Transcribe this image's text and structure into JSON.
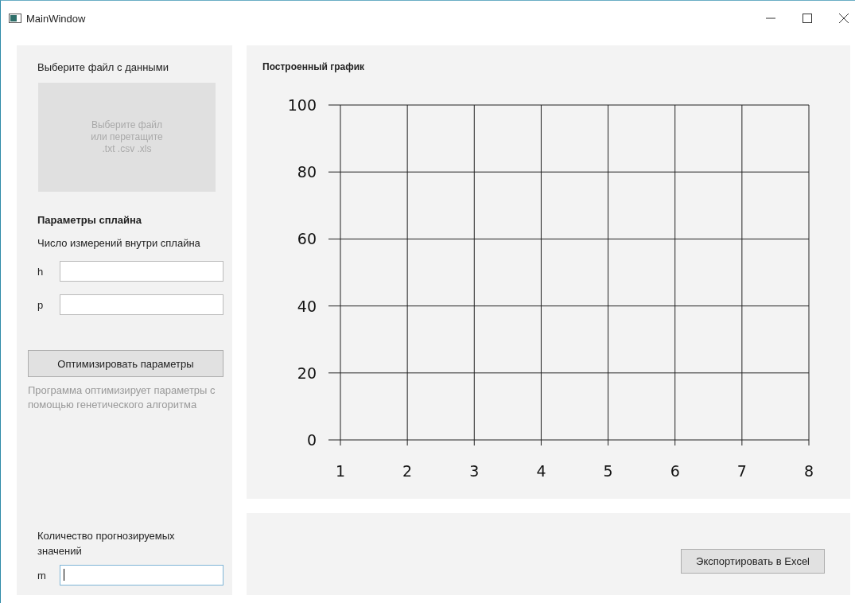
{
  "window": {
    "title": "MainWindow"
  },
  "file_section": {
    "label": "Выберите файл с данными",
    "drop_zone": [
      "Выберите файл",
      "или перетащите",
      ".txt .csv .xls"
    ]
  },
  "spline": {
    "heading": "Параметры сплайна",
    "subheading": "Число измерений внутри сплайна",
    "fields": [
      {
        "label": "h",
        "focused": false
      },
      {
        "label": "p",
        "focused": false
      }
    ]
  },
  "optimize": {
    "button": "Оптимизировать параметры",
    "note": "Программа оптимизирует параметры с помощью генетического алгоритма"
  },
  "forecast": {
    "label": "Количество прогнозируемых значений",
    "field": {
      "label": "m",
      "focused": true
    }
  },
  "chart": {
    "title": "Построенный график",
    "chart_data": {
      "type": "line",
      "xlim": [
        1,
        8
      ],
      "ylim": [
        0,
        100
      ],
      "xticks": [
        1,
        2,
        3,
        4,
        5,
        6,
        7,
        8
      ],
      "yticks": [
        0,
        20,
        40,
        60,
        80,
        100
      ],
      "grid": true
    }
  },
  "export_button": "Экспортировать в Excel"
}
